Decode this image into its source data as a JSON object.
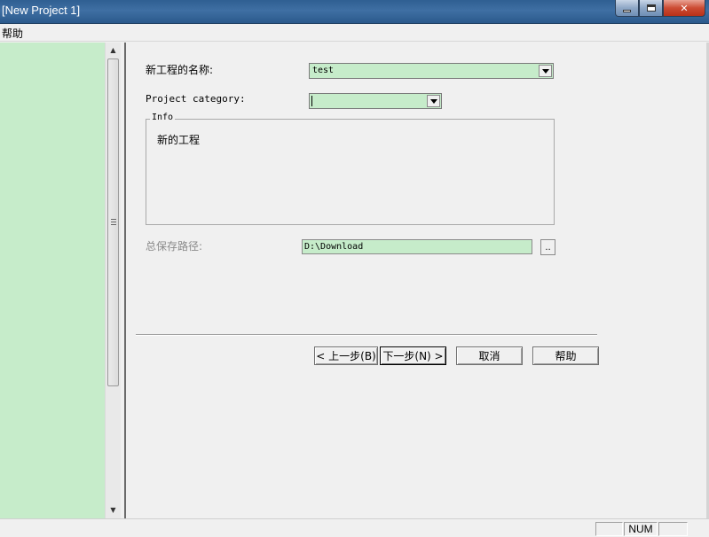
{
  "window": {
    "title": "[New Project 1]",
    "controls": {
      "minimize": "minimize-icon",
      "maximize": "maximize-icon",
      "close": "✕"
    }
  },
  "menu": {
    "items": [
      {
        "label": "帮助"
      }
    ]
  },
  "left_panel": {
    "background": "#c6ecca"
  },
  "form": {
    "project_name": {
      "label": "新工程的名称:",
      "value": "test"
    },
    "project_category": {
      "label": "Project category:",
      "value": ""
    },
    "info": {
      "title": "Info",
      "text": "新的工程"
    },
    "save_path": {
      "label": "总保存路径:",
      "value": "D:\\Download",
      "browse_label": ".."
    }
  },
  "buttons": {
    "back": "< 上一步(B)",
    "next": "下一步(N) >",
    "cancel": "取消",
    "help": "帮助"
  },
  "statusbar": {
    "panes": [
      "",
      "NUM",
      ""
    ]
  },
  "colors": {
    "field_background": "#c6ecca",
    "titlebar": "#3a6a9e"
  }
}
